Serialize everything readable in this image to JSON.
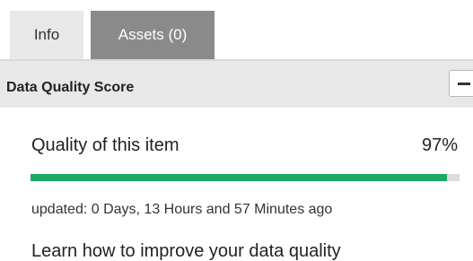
{
  "tabs": [
    {
      "label": "Info",
      "active": true
    },
    {
      "label": "Assets (0)",
      "active": false
    }
  ],
  "section": {
    "title": "Data Quality Score",
    "collapse_icon": "minus-icon"
  },
  "quality": {
    "label": "Quality of this item",
    "value_text": "97%",
    "progress_fraction": 0.97,
    "updated_text": "updated: 0 Days, 13 Hours and 57 Minutes ago"
  },
  "help": {
    "link_text": "Learn how to improve your data quality"
  },
  "colors": {
    "progress_fill": "#1fa763",
    "progress_track": "#dcdcdc",
    "inactive_tab": "#8a8a8a",
    "active_tab": "#e8e8e8"
  }
}
